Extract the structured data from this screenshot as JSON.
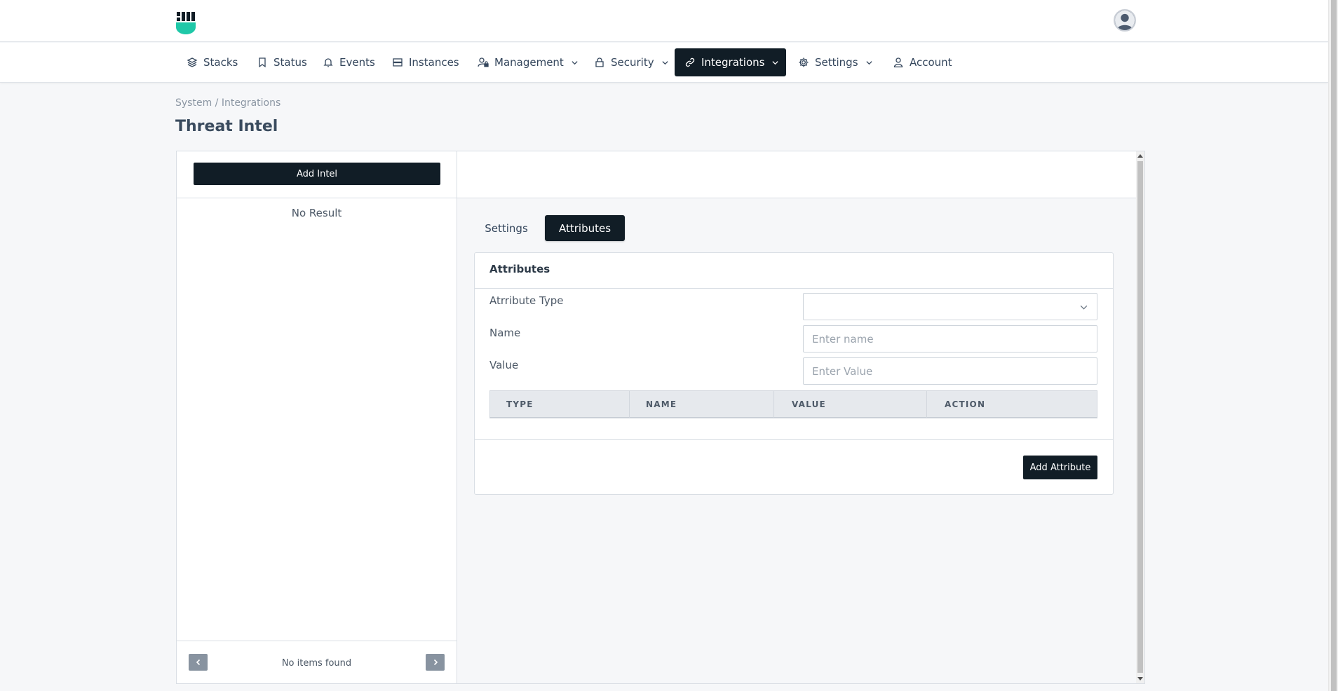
{
  "nav": {
    "items": [
      {
        "label": "Stacks",
        "icon": "layers-icon"
      },
      {
        "label": "Status",
        "icon": "bookmark-icon"
      },
      {
        "label": "Events",
        "icon": "bell-icon"
      },
      {
        "label": "Instances",
        "icon": "server-icon"
      },
      {
        "label": "Management",
        "icon": "user-lock-icon",
        "dropdown": true
      },
      {
        "label": "Security",
        "icon": "lock-icon",
        "dropdown": true
      },
      {
        "label": "Integrations",
        "icon": "link-icon",
        "dropdown": true,
        "active": true
      },
      {
        "label": "Settings",
        "icon": "gear-icon",
        "dropdown": true
      },
      {
        "label": "Account",
        "icon": "user-icon"
      }
    ]
  },
  "breadcrumb": "System / Integrations",
  "page_title": "Threat Intel",
  "left_panel": {
    "add_button": "Add Intel",
    "empty_text": "No Result",
    "footer_text": "No items found"
  },
  "tabs": [
    {
      "label": "Settings",
      "active": false
    },
    {
      "label": "Attributes",
      "active": true
    }
  ],
  "attributes_card": {
    "title": "Attributes",
    "fields": {
      "type_label": "Atrribute Type",
      "type_value": "",
      "name_label": "Name",
      "name_placeholder": "Enter name",
      "value_label": "Value",
      "value_placeholder": "Enter Value"
    },
    "table": {
      "columns": [
        "TYPE",
        "NAME",
        "VALUE",
        "ACTION"
      ],
      "rows": []
    },
    "add_button": "Add Attribute"
  },
  "colors": {
    "accent_dark": "#111d26",
    "logo_teal": "#1fc8a8",
    "background": "#f6f7f9"
  }
}
